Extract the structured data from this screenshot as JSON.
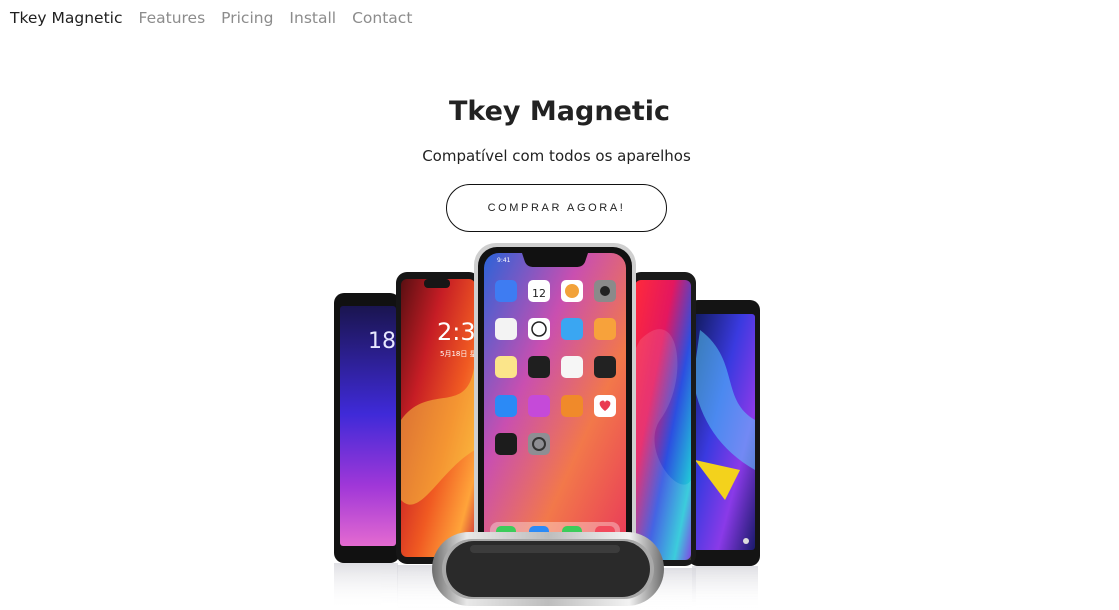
{
  "nav": {
    "brand": "Tkey Magnetic",
    "links": [
      "Features",
      "Pricing",
      "Install",
      "Contact"
    ]
  },
  "hero": {
    "title": "Tkey Magnetic",
    "subtitle": "Compatível com todos os aparelhos",
    "cta_label": "COMPRAR AGORA!"
  },
  "phones": {
    "left_time": "18",
    "mid_left_time": "2:3",
    "mid_left_date": "5月18日 星期五",
    "status_time": "9:41",
    "calendar_day": "12"
  },
  "colors": {
    "text": "#222222",
    "nav_muted": "#8c8c8c",
    "button_border": "#111111"
  }
}
